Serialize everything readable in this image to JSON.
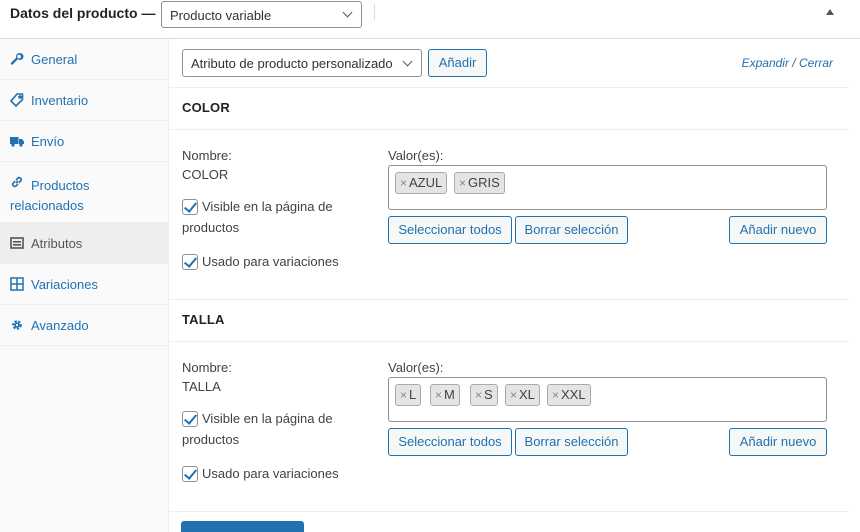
{
  "header": {
    "title": "Datos del producto —",
    "product_type": "Producto variable"
  },
  "sidebar": {
    "items": [
      {
        "label": "General",
        "icon": "wrench-icon"
      },
      {
        "label": "Inventario",
        "icon": "tag-icon"
      },
      {
        "label": "Envío",
        "icon": "truck-icon"
      },
      {
        "label": "Productos relacionados",
        "icon": "link-icon"
      },
      {
        "label": "Atributos",
        "icon": "list-icon",
        "active": true
      },
      {
        "label": "Variaciones",
        "icon": "grid-icon"
      },
      {
        "label": "Avanzado",
        "icon": "gear-icon"
      }
    ]
  },
  "toolbar": {
    "attribute_select": "Atributo de producto personalizado",
    "add_label": "Añadir",
    "expand_label": "Expandir",
    "separator": " / ",
    "close_label": "Cerrar"
  },
  "attributes": [
    {
      "heading": "COLOR",
      "name_label": "Nombre:",
      "name": "COLOR",
      "values_label": "Valor(es):",
      "values": [
        "AZUL",
        "GRIS"
      ],
      "visible_label": "Visible en la página de productos",
      "visible_checked": true,
      "variations_label": "Usado para variaciones",
      "variations_checked": true,
      "select_all_label": "Seleccionar todos",
      "clear_label": "Borrar selección",
      "add_new_label": "Añadir nuevo"
    },
    {
      "heading": "TALLA",
      "name_label": "Nombre:",
      "name": "TALLA",
      "values_label": "Valor(es):",
      "values": [
        "L",
        "M",
        "S",
        "XL",
        "XXL"
      ],
      "visible_label": "Visible en la página de productos",
      "visible_checked": true,
      "variations_label": "Usado para variaciones",
      "variations_checked": true,
      "select_all_label": "Seleccionar todos",
      "clear_label": "Borrar selección",
      "add_new_label": "Añadir nuevo"
    }
  ],
  "colors": {
    "accent": "#2271b1",
    "text": "#3c434a",
    "border": "#dcdcde",
    "sidebar_bg": "#fafafa",
    "active_tab_bg": "#eeeeee"
  }
}
